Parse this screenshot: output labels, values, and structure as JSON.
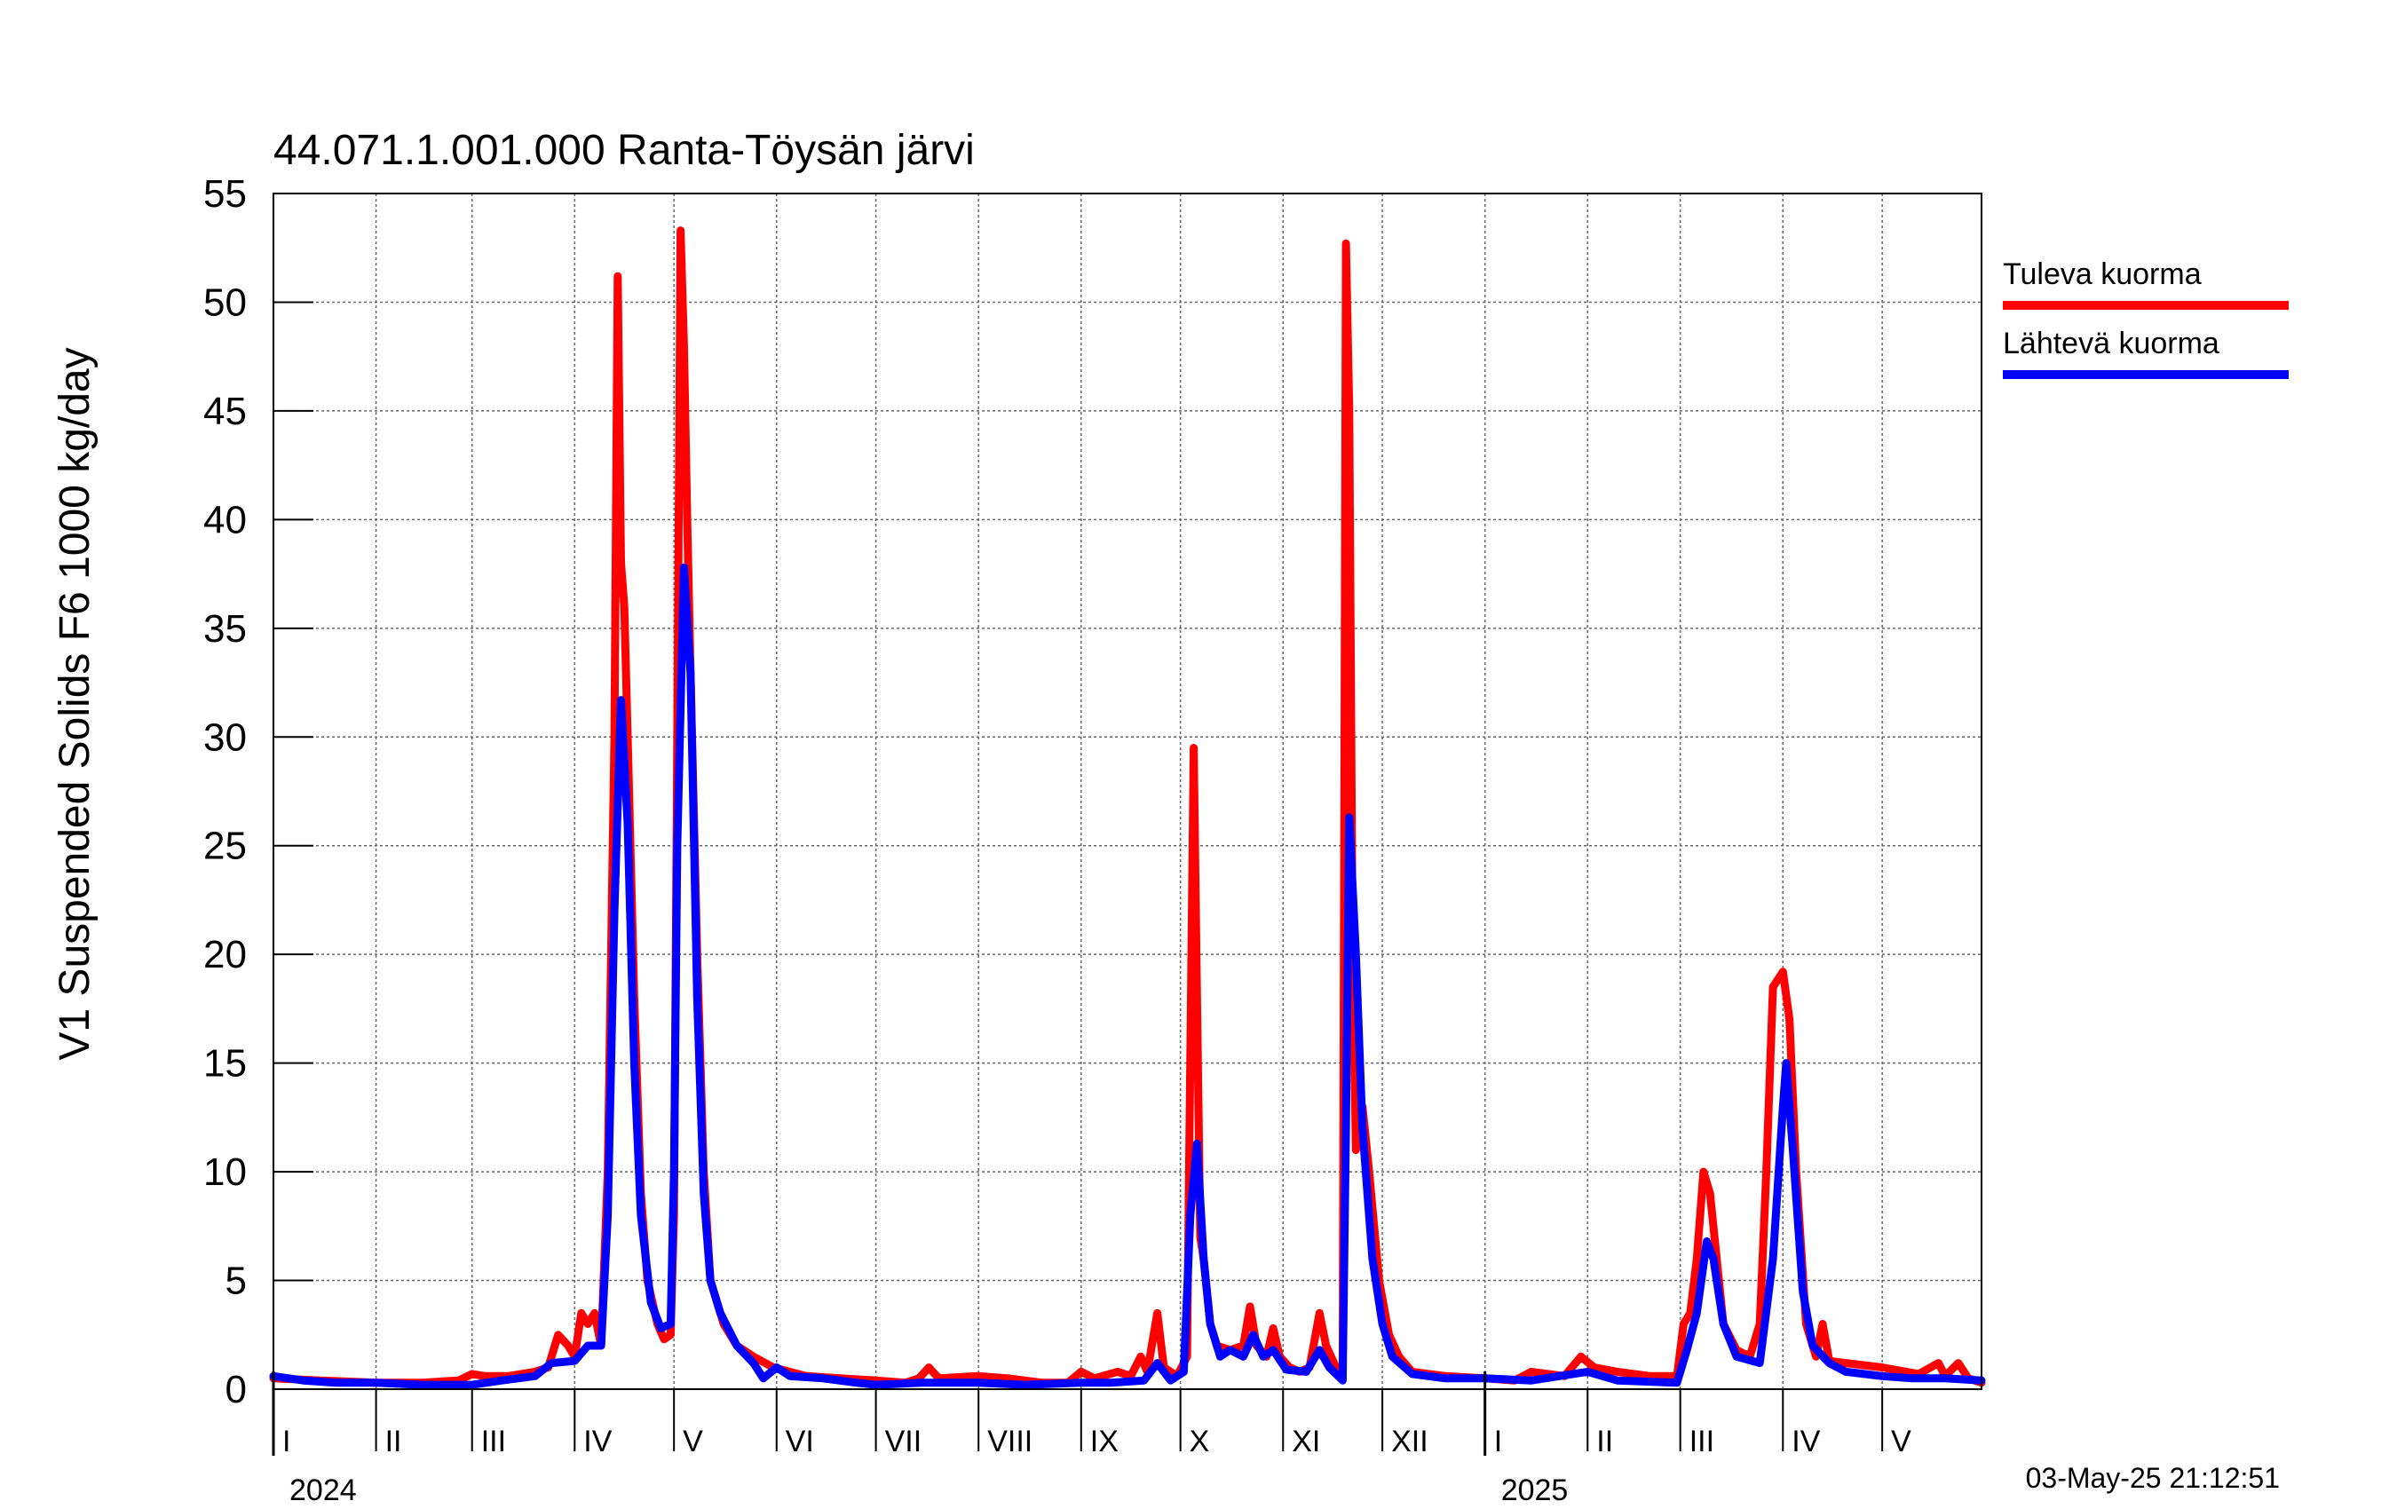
{
  "chart_data": {
    "type": "line",
    "title": "44.071.1.001.000 Ranta-Töysän järvi",
    "ylabel": "V1 Suspended Solids F6 1000 kg/day",
    "xlabel": "",
    "ylim": [
      0,
      55
    ],
    "yticks": [
      0,
      5,
      10,
      15,
      20,
      25,
      30,
      35,
      40,
      45,
      50,
      55
    ],
    "xlim": [
      "2024-01-01",
      "2025-05-31"
    ],
    "grid": true,
    "legend_position": "top-right",
    "timestamp": "03-May-25 21:12:51",
    "year_labels": [
      {
        "label": "2024",
        "date": "2024-01-01"
      },
      {
        "label": "2025",
        "date": "2025-01-01"
      }
    ],
    "month_labels": [
      {
        "label": "I",
        "date": "2024-01-01"
      },
      {
        "label": "II",
        "date": "2024-02-01"
      },
      {
        "label": "III",
        "date": "2024-03-01"
      },
      {
        "label": "IV",
        "date": "2024-04-01"
      },
      {
        "label": "V",
        "date": "2024-05-01"
      },
      {
        "label": "VI",
        "date": "2024-06-01"
      },
      {
        "label": "VII",
        "date": "2024-07-01"
      },
      {
        "label": "VIII",
        "date": "2024-08-01"
      },
      {
        "label": "IX",
        "date": "2024-09-01"
      },
      {
        "label": "X",
        "date": "2024-10-01"
      },
      {
        "label": "XI",
        "date": "2024-11-01"
      },
      {
        "label": "XII",
        "date": "2024-12-01"
      },
      {
        "label": "I",
        "date": "2025-01-01"
      },
      {
        "label": "II",
        "date": "2025-02-01"
      },
      {
        "label": "III",
        "date": "2025-03-01"
      },
      {
        "label": "IV",
        "date": "2025-04-01"
      },
      {
        "label": "V",
        "date": "2025-05-01"
      }
    ],
    "series": [
      {
        "name": "Tuleva kuorma",
        "color": "#ff0000",
        "points": [
          [
            "2024-01-01",
            0.5
          ],
          [
            "2024-01-15",
            0.4
          ],
          [
            "2024-02-01",
            0.3
          ],
          [
            "2024-02-15",
            0.3
          ],
          [
            "2024-02-26",
            0.4
          ],
          [
            "2024-03-01",
            0.7
          ],
          [
            "2024-03-05",
            0.6
          ],
          [
            "2024-03-12",
            0.6
          ],
          [
            "2024-03-20",
            0.8
          ],
          [
            "2024-03-24",
            1.0
          ],
          [
            "2024-03-27",
            2.5
          ],
          [
            "2024-03-30",
            2.0
          ],
          [
            "2024-04-01",
            1.5
          ],
          [
            "2024-04-03",
            3.5
          ],
          [
            "2024-04-05",
            3.0
          ],
          [
            "2024-04-07",
            3.5
          ],
          [
            "2024-04-09",
            2.0
          ],
          [
            "2024-04-11",
            10.0
          ],
          [
            "2024-04-13",
            30.0
          ],
          [
            "2024-04-14",
            51.2
          ],
          [
            "2024-04-15",
            38.0
          ],
          [
            "2024-04-16",
            36.0
          ],
          [
            "2024-04-17",
            30.0
          ],
          [
            "2024-04-19",
            18.0
          ],
          [
            "2024-04-21",
            9.0
          ],
          [
            "2024-04-23",
            5.0
          ],
          [
            "2024-04-26",
            3.0
          ],
          [
            "2024-04-28",
            2.3
          ],
          [
            "2024-04-30",
            2.5
          ],
          [
            "2024-05-01",
            8.0
          ],
          [
            "2024-05-02",
            30.0
          ],
          [
            "2024-05-03",
            53.3
          ],
          [
            "2024-05-04",
            48.0
          ],
          [
            "2024-05-05",
            40.0
          ],
          [
            "2024-05-06",
            33.0
          ],
          [
            "2024-05-08",
            20.0
          ],
          [
            "2024-05-10",
            10.0
          ],
          [
            "2024-05-12",
            5.0
          ],
          [
            "2024-05-16",
            3.0
          ],
          [
            "2024-05-20",
            2.0
          ],
          [
            "2024-05-25",
            1.5
          ],
          [
            "2024-05-31",
            1.0
          ],
          [
            "2024-06-10",
            0.6
          ],
          [
            "2024-06-20",
            0.5
          ],
          [
            "2024-07-01",
            0.4
          ],
          [
            "2024-07-10",
            0.3
          ],
          [
            "2024-07-14",
            0.5
          ],
          [
            "2024-07-17",
            1.0
          ],
          [
            "2024-07-20",
            0.5
          ],
          [
            "2024-08-01",
            0.6
          ],
          [
            "2024-08-10",
            0.5
          ],
          [
            "2024-08-20",
            0.3
          ],
          [
            "2024-08-28",
            0.3
          ],
          [
            "2024-09-01",
            0.8
          ],
          [
            "2024-09-05",
            0.5
          ],
          [
            "2024-09-12",
            0.8
          ],
          [
            "2024-09-16",
            0.6
          ],
          [
            "2024-09-19",
            1.5
          ],
          [
            "2024-09-21",
            0.8
          ],
          [
            "2024-09-24",
            3.5
          ],
          [
            "2024-09-26",
            1.0
          ],
          [
            "2024-09-30",
            0.6
          ],
          [
            "2024-10-03",
            1.5
          ],
          [
            "2024-10-05",
            29.5
          ],
          [
            "2024-10-06",
            18.0
          ],
          [
            "2024-10-07",
            7.0
          ],
          [
            "2024-10-08",
            6.0
          ],
          [
            "2024-10-10",
            3.0
          ],
          [
            "2024-10-12",
            2.0
          ],
          [
            "2024-10-16",
            1.8
          ],
          [
            "2024-10-20",
            2.0
          ],
          [
            "2024-10-22",
            3.8
          ],
          [
            "2024-10-24",
            2.0
          ],
          [
            "2024-10-27",
            1.5
          ],
          [
            "2024-10-29",
            2.8
          ],
          [
            "2024-10-31",
            1.5
          ],
          [
            "2024-11-03",
            1.0
          ],
          [
            "2024-11-06",
            0.8
          ],
          [
            "2024-11-09",
            1.0
          ],
          [
            "2024-11-12",
            3.5
          ],
          [
            "2024-11-14",
            2.0
          ],
          [
            "2024-11-17",
            1.0
          ],
          [
            "2024-11-19",
            0.5
          ],
          [
            "2024-11-20",
            52.7
          ],
          [
            "2024-11-21",
            45.0
          ],
          [
            "2024-11-22",
            20.0
          ],
          [
            "2024-11-23",
            11.0
          ],
          [
            "2024-11-25",
            13.0
          ],
          [
            "2024-11-27",
            10.0
          ],
          [
            "2024-11-30",
            5.0
          ],
          [
            "2024-12-03",
            2.5
          ],
          [
            "2024-12-06",
            1.5
          ],
          [
            "2024-12-10",
            0.8
          ],
          [
            "2024-12-20",
            0.6
          ],
          [
            "2025-01-01",
            0.5
          ],
          [
            "2025-01-10",
            0.4
          ],
          [
            "2025-01-15",
            0.8
          ],
          [
            "2025-01-25",
            0.6
          ],
          [
            "2025-01-30",
            1.5
          ],
          [
            "2025-02-03",
            1.0
          ],
          [
            "2025-02-10",
            0.8
          ],
          [
            "2025-02-20",
            0.6
          ],
          [
            "2025-02-28",
            0.6
          ],
          [
            "2025-03-02",
            3.0
          ],
          [
            "2025-03-04",
            3.5
          ],
          [
            "2025-03-06",
            6.0
          ],
          [
            "2025-03-08",
            10.0
          ],
          [
            "2025-03-10",
            9.0
          ],
          [
            "2025-03-12",
            6.0
          ],
          [
            "2025-03-14",
            3.0
          ],
          [
            "2025-03-18",
            1.8
          ],
          [
            "2025-03-22",
            1.5
          ],
          [
            "2025-03-25",
            3.0
          ],
          [
            "2025-03-27",
            10.0
          ],
          [
            "2025-03-29",
            18.5
          ],
          [
            "2025-04-01",
            19.2
          ],
          [
            "2025-04-03",
            17.0
          ],
          [
            "2025-04-05",
            10.0
          ],
          [
            "2025-04-08",
            3.0
          ],
          [
            "2025-04-11",
            1.5
          ],
          [
            "2025-04-13",
            3.0
          ],
          [
            "2025-04-15",
            1.3
          ],
          [
            "2025-04-20",
            1.2
          ],
          [
            "2025-05-01",
            1.0
          ],
          [
            "2025-05-12",
            0.7
          ],
          [
            "2025-05-18",
            1.2
          ],
          [
            "2025-05-20",
            0.6
          ],
          [
            "2025-05-24",
            1.2
          ],
          [
            "2025-05-27",
            0.5
          ],
          [
            "2025-05-31",
            0.3
          ]
        ]
      },
      {
        "name": "Lähtevä kuorma",
        "color": "#0000ff",
        "points": [
          [
            "2024-01-01",
            0.6
          ],
          [
            "2024-01-10",
            0.4
          ],
          [
            "2024-01-20",
            0.3
          ],
          [
            "2024-02-01",
            0.3
          ],
          [
            "2024-02-15",
            0.2
          ],
          [
            "2024-03-01",
            0.2
          ],
          [
            "2024-03-10",
            0.4
          ],
          [
            "2024-03-20",
            0.6
          ],
          [
            "2024-03-25",
            1.2
          ],
          [
            "2024-04-01",
            1.3
          ],
          [
            "2024-04-05",
            2.0
          ],
          [
            "2024-04-09",
            2.0
          ],
          [
            "2024-04-11",
            8.0
          ],
          [
            "2024-04-13",
            22.0
          ],
          [
            "2024-04-15",
            31.7
          ],
          [
            "2024-04-17",
            26.0
          ],
          [
            "2024-04-19",
            15.0
          ],
          [
            "2024-04-21",
            8.0
          ],
          [
            "2024-04-24",
            4.0
          ],
          [
            "2024-04-27",
            2.8
          ],
          [
            "2024-04-30",
            3.0
          ],
          [
            "2024-05-01",
            10.0
          ],
          [
            "2024-05-02",
            25.0
          ],
          [
            "2024-05-04",
            37.8
          ],
          [
            "2024-05-06",
            33.0
          ],
          [
            "2024-05-08",
            18.0
          ],
          [
            "2024-05-10",
            9.0
          ],
          [
            "2024-05-12",
            5.0
          ],
          [
            "2024-05-15",
            3.5
          ],
          [
            "2024-05-20",
            2.0
          ],
          [
            "2024-05-25",
            1.2
          ],
          [
            "2024-05-28",
            0.5
          ],
          [
            "2024-06-01",
            1.0
          ],
          [
            "2024-06-05",
            0.6
          ],
          [
            "2024-06-15",
            0.5
          ],
          [
            "2024-06-25",
            0.3
          ],
          [
            "2024-07-01",
            0.2
          ],
          [
            "2024-07-15",
            0.3
          ],
          [
            "2024-08-01",
            0.3
          ],
          [
            "2024-08-15",
            0.2
          ],
          [
            "2024-09-01",
            0.3
          ],
          [
            "2024-09-10",
            0.3
          ],
          [
            "2024-09-20",
            0.4
          ],
          [
            "2024-09-24",
            1.2
          ],
          [
            "2024-09-28",
            0.4
          ],
          [
            "2024-10-02",
            0.8
          ],
          [
            "2024-10-04",
            8.0
          ],
          [
            "2024-10-06",
            11.3
          ],
          [
            "2024-10-08",
            6.0
          ],
          [
            "2024-10-10",
            3.0
          ],
          [
            "2024-10-13",
            1.5
          ],
          [
            "2024-10-16",
            1.8
          ],
          [
            "2024-10-20",
            1.5
          ],
          [
            "2024-10-23",
            2.5
          ],
          [
            "2024-10-26",
            1.5
          ],
          [
            "2024-10-29",
            1.8
          ],
          [
            "2024-11-02",
            0.9
          ],
          [
            "2024-11-08",
            0.8
          ],
          [
            "2024-11-12",
            1.8
          ],
          [
            "2024-11-15",
            1.0
          ],
          [
            "2024-11-19",
            0.4
          ],
          [
            "2024-11-20",
            12.0
          ],
          [
            "2024-11-21",
            26.3
          ],
          [
            "2024-11-23",
            20.0
          ],
          [
            "2024-11-25",
            12.0
          ],
          [
            "2024-11-28",
            6.0
          ],
          [
            "2024-12-01",
            3.0
          ],
          [
            "2024-12-04",
            1.5
          ],
          [
            "2024-12-10",
            0.7
          ],
          [
            "2024-12-20",
            0.5
          ],
          [
            "2025-01-01",
            0.5
          ],
          [
            "2025-01-15",
            0.4
          ],
          [
            "2025-02-01",
            0.8
          ],
          [
            "2025-02-10",
            0.4
          ],
          [
            "2025-02-28",
            0.3
          ],
          [
            "2025-03-03",
            1.8
          ],
          [
            "2025-03-06",
            3.5
          ],
          [
            "2025-03-09",
            6.8
          ],
          [
            "2025-03-11",
            6.0
          ],
          [
            "2025-03-14",
            3.0
          ],
          [
            "2025-03-18",
            1.5
          ],
          [
            "2025-03-25",
            1.2
          ],
          [
            "2025-03-29",
            6.0
          ],
          [
            "2025-04-01",
            13.0
          ],
          [
            "2025-04-02",
            15.0
          ],
          [
            "2025-04-04",
            11.0
          ],
          [
            "2025-04-07",
            4.5
          ],
          [
            "2025-04-10",
            2.0
          ],
          [
            "2025-04-15",
            1.2
          ],
          [
            "2025-04-20",
            0.8
          ],
          [
            "2025-05-01",
            0.6
          ],
          [
            "2025-05-10",
            0.5
          ],
          [
            "2025-05-20",
            0.5
          ],
          [
            "2025-05-31",
            0.4
          ]
        ]
      }
    ]
  }
}
